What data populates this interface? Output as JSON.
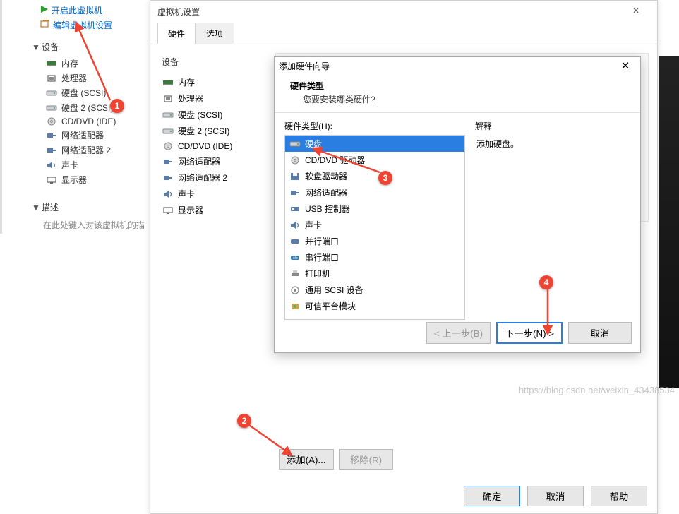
{
  "sidebar": {
    "power_on_label": "开启此虚拟机",
    "edit_label": "编辑虚拟机设置",
    "devices_header": "设备",
    "devices": [
      {
        "icon": "memory",
        "label": "内存"
      },
      {
        "icon": "cpu",
        "label": "处理器"
      },
      {
        "icon": "disk",
        "label": "硬盘 (SCSI)"
      },
      {
        "icon": "disk",
        "label": "硬盘 2 (SCSI)"
      },
      {
        "icon": "cd",
        "label": "CD/DVD (IDE)"
      },
      {
        "icon": "net",
        "label": "网络适配器"
      },
      {
        "icon": "net",
        "label": "网络适配器 2"
      },
      {
        "icon": "sound",
        "label": "声卡"
      },
      {
        "icon": "display",
        "label": "显示器"
      }
    ],
    "desc_header": "描述",
    "desc_placeholder": "在此处键入对该虚拟机的描"
  },
  "vm_settings": {
    "title": "虚拟机设置",
    "tabs": [
      "硬件",
      "选项"
    ],
    "device_col_header": "设备",
    "devices": [
      {
        "icon": "memory",
        "label": "内存"
      },
      {
        "icon": "cpu",
        "label": "处理器"
      },
      {
        "icon": "disk",
        "label": "硬盘 (SCSI)"
      },
      {
        "icon": "disk",
        "label": "硬盘 2 (SCSI)"
      },
      {
        "icon": "cd",
        "label": "CD/DVD (IDE)"
      },
      {
        "icon": "net",
        "label": "网络适配器"
      },
      {
        "icon": "net",
        "label": "网络适配器 2"
      },
      {
        "icon": "sound",
        "label": "声卡"
      },
      {
        "icon": "display",
        "label": "显示器"
      }
    ],
    "add_btn": "添加(A)...",
    "remove_btn": "移除(R)",
    "ok_btn": "确定",
    "cancel_btn": "取消",
    "help_btn": "帮助"
  },
  "wizard": {
    "title": "添加硬件向导",
    "head_title": "硬件类型",
    "head_sub": "您要安装哪类硬件?",
    "hw_label": "硬件类型(H):",
    "exp_label": "解释",
    "exp_text": "添加硬盘。",
    "items": [
      {
        "icon": "disk",
        "label": "硬盘",
        "selected": true
      },
      {
        "icon": "cd",
        "label": "CD/DVD 驱动器"
      },
      {
        "icon": "floppy",
        "label": "软盘驱动器"
      },
      {
        "icon": "net",
        "label": "网络适配器"
      },
      {
        "icon": "usb",
        "label": "USB 控制器"
      },
      {
        "icon": "sound",
        "label": "声卡"
      },
      {
        "icon": "parallel",
        "label": "并行端口"
      },
      {
        "icon": "serial",
        "label": "串行端口"
      },
      {
        "icon": "printer",
        "label": "打印机"
      },
      {
        "icon": "scsi",
        "label": "通用 SCSI 设备"
      },
      {
        "icon": "tpm",
        "label": "可信平台模块"
      }
    ],
    "back_btn": "< 上一步(B)",
    "next_btn": "下一步(N) >",
    "cancel_btn": "取消"
  },
  "markers": {
    "m1": "1",
    "m2": "2",
    "m3": "3",
    "m4": "4"
  },
  "watermark": "https://blog.csdn.net/weixin_43438534"
}
